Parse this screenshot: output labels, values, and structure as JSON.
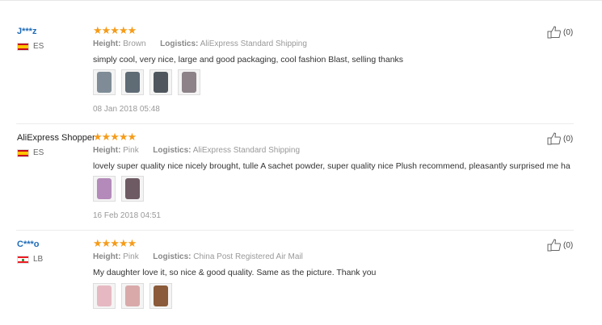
{
  "reviews": [
    {
      "user": "J***z",
      "country": "ES",
      "flag": "flag-es",
      "rating": 5,
      "stars": "★★★★★",
      "height_label": "Height:",
      "height_value": "Brown",
      "logistics_label": "Logistics:",
      "logistics_value": "AliExpress Standard Shipping",
      "text": "simply cool, very nice, large and good packaging, cool fashion Blast, selling thanks",
      "photos": [
        {
          "icon": "dress-photo",
          "color": "#7f8c97"
        },
        {
          "icon": "dress-photo",
          "color": "#5f6b75"
        },
        {
          "icon": "dress-photo",
          "color": "#4f565e"
        },
        {
          "icon": "dress-photo",
          "color": "#8c8287"
        }
      ],
      "date": "08 Jan 2018 05:48",
      "likes": "(0)"
    },
    {
      "user": "AliExpress Shopper",
      "country": "ES",
      "flag": "flag-es",
      "rating": 5,
      "stars": "★★★★★",
      "height_label": "Height:",
      "height_value": "Pink",
      "logistics_label": "Logistics:",
      "logistics_value": "AliExpress Standard Shipping",
      "text": "lovely super quality nice nicely brought, tulle A sachet powder, super quality nice Plush recommend, pleasantly surprised me ha",
      "photos": [
        {
          "icon": "dress-photo",
          "color": "#b38ab9"
        },
        {
          "icon": "dress-photo",
          "color": "#6d5a63"
        }
      ],
      "date": "16 Feb 2018 04:51",
      "likes": "(0)"
    },
    {
      "user": "C***o",
      "country": "LB",
      "flag": "flag-lb",
      "rating": 5,
      "stars": "★★★★★",
      "height_label": "Height:",
      "height_value": "Pink",
      "logistics_label": "Logistics:",
      "logistics_value": "China Post Registered Air Mail",
      "text": "My daughter love it, so nice & good quality. Same as the picture. Thank you",
      "photos": [
        {
          "icon": "dress-photo",
          "color": "#e6b9c2"
        },
        {
          "icon": "dress-photo",
          "color": "#d9a9a9"
        },
        {
          "icon": "dress-photo",
          "color": "#8a5a3a"
        }
      ],
      "date": "",
      "likes": "(0)"
    }
  ]
}
